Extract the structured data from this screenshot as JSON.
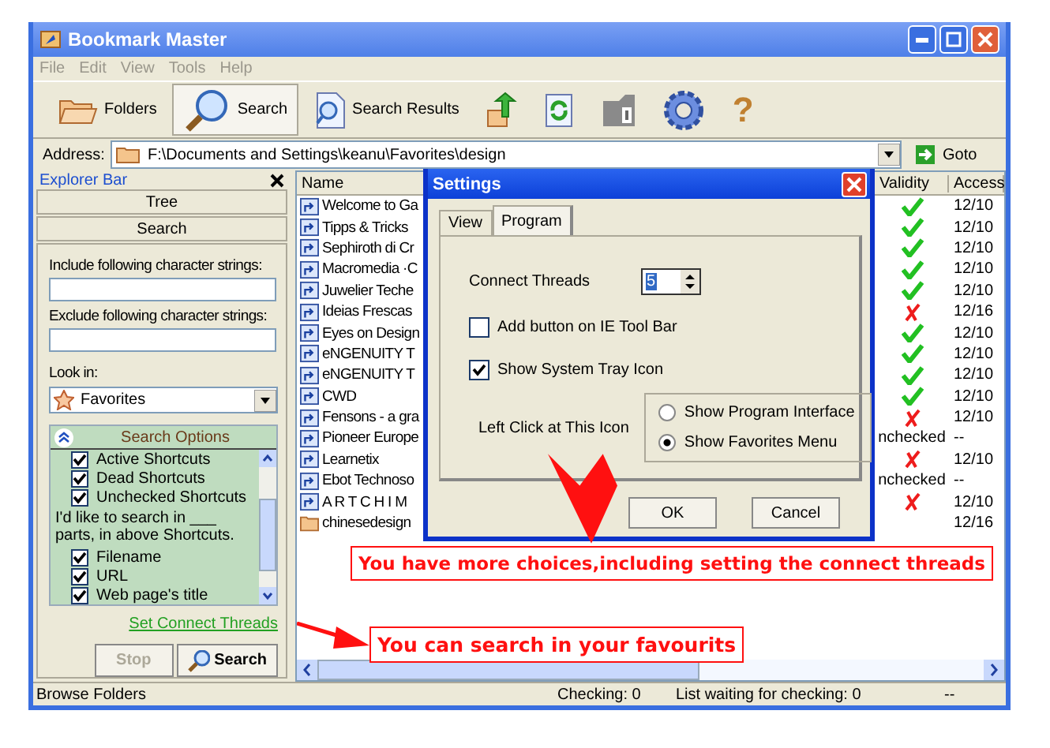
{
  "window": {
    "title": "Bookmark Master"
  },
  "menu": [
    "File",
    "Edit",
    "View",
    "Tools",
    "Help"
  ],
  "toolbar": [
    {
      "kind": "folders",
      "label": "Folders",
      "selected": false
    },
    {
      "kind": "search",
      "label": "Search",
      "selected": true
    },
    {
      "kind": "results",
      "label": "Search Results",
      "selected": false
    },
    {
      "kind": "up",
      "selected": false
    },
    {
      "kind": "refresh",
      "selected": false
    },
    {
      "kind": "info",
      "selected": false
    },
    {
      "kind": "gear",
      "selected": false
    },
    {
      "kind": "help",
      "glyph": "?",
      "selected": false
    }
  ],
  "address": {
    "label": "Address:",
    "value": "F:\\Documents and Settings\\keanu\\Favorites\\design",
    "button": "Goto"
  },
  "explorer_bar": {
    "title": "Explorer Bar",
    "tabs": [
      "Tree",
      "Search"
    ],
    "include_label": "Include following character strings:",
    "exclude_label": "Exclude following character strings:",
    "look_in_label": "Look in:",
    "look_in_value": "Favorites",
    "options": {
      "title": "Search Options",
      "items": [
        {
          "kind": "check",
          "label": "Active Shortcuts",
          "checked": true
        },
        {
          "kind": "check",
          "label": "Dead Shortcuts",
          "checked": true
        },
        {
          "kind": "check",
          "label": "Unchecked Shortcuts",
          "checked": true
        },
        {
          "kind": "note",
          "label": "I'd like to search in ___ parts, in above Shortcuts."
        },
        {
          "kind": "check",
          "label": "Filename",
          "checked": true
        },
        {
          "kind": "check",
          "label": "URL",
          "checked": true
        },
        {
          "kind": "check",
          "label": "Web page's title",
          "checked": true
        }
      ]
    },
    "link": "Set Connect Threads",
    "buttons": [
      {
        "kind": "plain",
        "label": "Stop",
        "disabled": true
      },
      {
        "kind": "search",
        "label": "Search",
        "disabled": false
      }
    ]
  },
  "list": {
    "columns": [
      "Name",
      "Validity",
      "Access"
    ],
    "rows": [
      {
        "kind": "shortcut",
        "name": "Welcome to Ga",
        "valid": true,
        "access": "12/10"
      },
      {
        "kind": "shortcut",
        "name": "Tipps & Tricks",
        "valid": true,
        "access": "12/10"
      },
      {
        "kind": "shortcut",
        "name": "Sephiroth di Cr",
        "valid": true,
        "access": "12/10"
      },
      {
        "kind": "shortcut",
        "name": "Macromedia ·C",
        "valid": true,
        "access": "12/10"
      },
      {
        "kind": "shortcut",
        "name": "Juwelier Teche",
        "valid": true,
        "access": "12/10"
      },
      {
        "kind": "shortcut",
        "name": "Ideias Frescas",
        "valid": false,
        "access": "12/16"
      },
      {
        "kind": "shortcut",
        "name": "Eyes on Design",
        "valid": true,
        "access": "12/10"
      },
      {
        "kind": "shortcut",
        "name": "eNGENUITY T",
        "valid": true,
        "access": "12/10"
      },
      {
        "kind": "shortcut",
        "name": "eNGENUITY T",
        "valid": true,
        "access": "12/10"
      },
      {
        "kind": "shortcut",
        "name": "CWD",
        "valid": true,
        "access": "12/10"
      },
      {
        "kind": "shortcut",
        "name": "Fensons - a gra",
        "valid": false,
        "access": "12/10"
      },
      {
        "kind": "shortcut",
        "name": "Pioneer Europe",
        "validity_text": "nchecked",
        "access": "--"
      },
      {
        "kind": "shortcut",
        "name": "Learnetix",
        "valid": false,
        "access": "12/10"
      },
      {
        "kind": "shortcut",
        "name": "Ebot Technoso",
        "validity_text": "nchecked",
        "access": "--"
      },
      {
        "kind": "shortcut",
        "name": "A R T C H I M",
        "valid": false,
        "access": "12/10"
      },
      {
        "kind": "folder",
        "name": "chinesedesign",
        "access": "12/16"
      }
    ]
  },
  "dialog": {
    "title": "Settings",
    "tabs": [
      {
        "label": "View",
        "selected": false
      },
      {
        "label": "Program",
        "selected": true
      }
    ],
    "threads_label": "Connect Threads",
    "threads_value": "5",
    "checks": [
      {
        "label": "Add button on IE Tool Bar",
        "checked": false
      },
      {
        "label": "Show System Tray Icon",
        "checked": true
      }
    ],
    "click_label": "Left Click at This Icon",
    "radios": [
      {
        "label": "Show Program Interface",
        "selected": false
      },
      {
        "label": "Show Favorites Menu",
        "selected": true
      }
    ],
    "buttons": [
      "OK",
      "Cancel"
    ]
  },
  "callouts": [
    "You have more choices,including setting the connect threads",
    "You can search in your favourits"
  ],
  "status_bar": [
    "Browse Folders",
    "Checking: 0",
    "List waiting for checking: 0",
    "--"
  ]
}
